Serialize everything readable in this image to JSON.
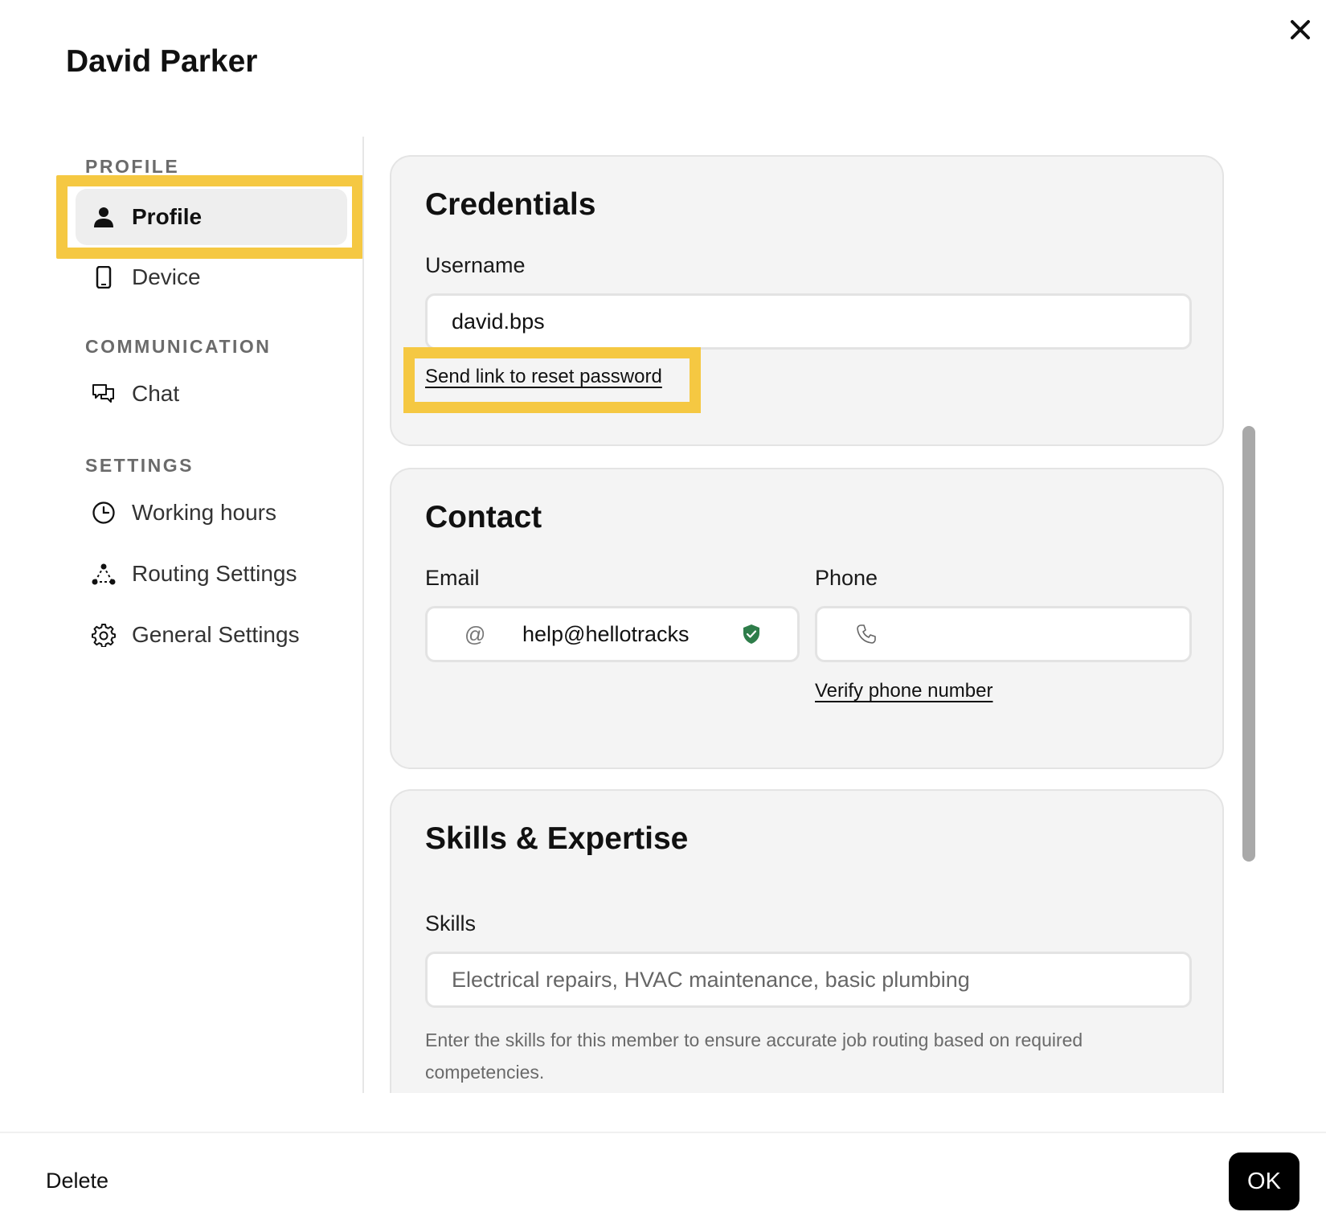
{
  "header": {
    "title": "David Parker"
  },
  "sidebar": {
    "sections": {
      "profile": "PROFILE",
      "communication": "COMMUNICATION",
      "settings": "SETTINGS"
    },
    "items": {
      "profile": "Profile",
      "device": "Device",
      "chat": "Chat",
      "working_hours": "Working hours",
      "routing_settings": "Routing Settings",
      "general_settings": "General Settings"
    },
    "active": "Profile"
  },
  "credentials": {
    "title": "Credentials",
    "username_label": "Username",
    "username_value": "david.bps",
    "reset_link": "Send link to reset password"
  },
  "contact": {
    "title": "Contact",
    "email_label": "Email",
    "email_value": "help@hellotracks",
    "email_prefix": "@",
    "phone_label": "Phone",
    "phone_value": "",
    "verify_link": "Verify phone number"
  },
  "skills": {
    "title": "Skills & Expertise",
    "skills_label": "Skills",
    "skills_placeholder": "Electrical repairs, HVAC maintenance, basic plumbing",
    "helper_text": "Enter the skills for this member to ensure accurate job routing based on required competencies."
  },
  "footer": {
    "delete_label": "Delete",
    "ok_label": "OK"
  },
  "colors": {
    "highlight": "#f5c842",
    "verified": "#2e7d4a",
    "ok_button": "#000000"
  }
}
